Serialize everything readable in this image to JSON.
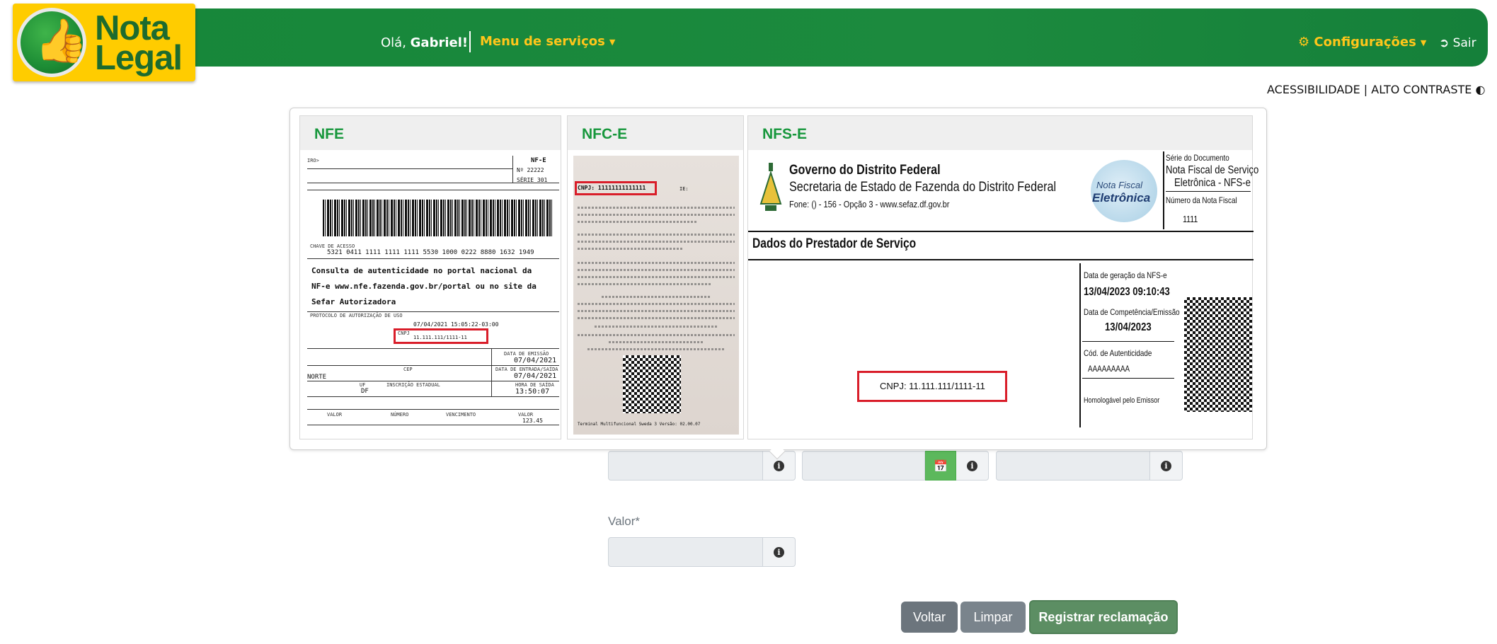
{
  "header": {
    "logo_text": [
      "Nota",
      "Legal"
    ],
    "greeting_prefix": "Olá,",
    "greeting_name": "Gabriel!",
    "services_menu": "Menu de serviços",
    "config_menu": "Configurações",
    "logout": "Sair",
    "accessibility": "ACESSIBILIDADE | ALTO CONTRASTE"
  },
  "popover": {
    "nfe": {
      "title": "NFE",
      "doc_type": "NF-E",
      "number_label": "Nº",
      "number": "22222",
      "serie_label": "SÉRIE",
      "serie": "301",
      "access_key_label": "CHAVE DE ACESSO",
      "access_key": "5321 0411 1111 1111 1111 5530 1000 0222 8880 1632 1949",
      "consult_lines": [
        "Consulta de autenticidade no portal nacional da",
        "NF-e www.nfe.fazenda.gov.br/portal ou no site da",
        "Sefar Autorizadora"
      ],
      "protocol_label": "PROTOCOLO DE AUTORIZAÇÃO DE USO",
      "protocol": "07/04/2021 15:05:22-03:00",
      "cnpj_label": "CNPJ",
      "cnpj": "11.111.111/1111-11",
      "emission_label": "DATA DE EMISSÃO",
      "emission": "07/04/2021",
      "entry_label": "DATA DE ENTRADA/SAÍDA",
      "entry": "07/04/2021",
      "exit_time_label": "HORA DE SAÍDA",
      "exit_time": "13:50:07",
      "uf_label": "UF",
      "uf": "DF",
      "cep_label": "CEP",
      "ie_label": "INSCRIÇÃO ESTADUAL",
      "norte": "NORTE",
      "bottom_labels": [
        "VALOR",
        "NÚMERO",
        "VENCIMENTO",
        "VALOR"
      ],
      "value": "123.45"
    },
    "nfce": {
      "title": "NFC-E",
      "cnpj": "CNPJ: 11111111111111",
      "ie": "IE:",
      "terminal": "Terminal Multifuncional Sweda 3    Versão: 02.00.07"
    },
    "nfse": {
      "title": "NFS-E",
      "gov_title": "Governo do Distrito Federal",
      "gov_sub": "Secretaria de Estado de Fazenda do Distrito Federal",
      "gov_phone": "Fone: () - 156 - Opção 3 - www.sefaz.df.gov.br",
      "logo_line1": "Nota Fiscal",
      "logo_line2": "Eletrônica",
      "serie_doc": "Série do Documento",
      "doc_name": [
        "Nota Fiscal de Serviço",
        "Eletrônica - NFS-e"
      ],
      "number_label": "Número da Nota Fiscal",
      "number": "1111",
      "provider_title": "Dados do Prestador de Serviço",
      "gen_date_label": "Data de geração da NFS-e",
      "gen_date": "13/04/2023 09:10:43",
      "comp_label": "Data de Competência/Emissão",
      "comp_date": "13/04/2023",
      "auth_label": "Cód. de Autenticidade",
      "auth_code": "AAAAAAAAA",
      "verify": "Homologável pelo Emissor",
      "cnpj": "CNPJ: 11.111.111/1111-11"
    }
  },
  "form": {
    "valor_label": "Valor*"
  },
  "buttons": {
    "voltar": "Voltar",
    "limpar": "Limpar",
    "registrar": "Registrar reclamação"
  }
}
